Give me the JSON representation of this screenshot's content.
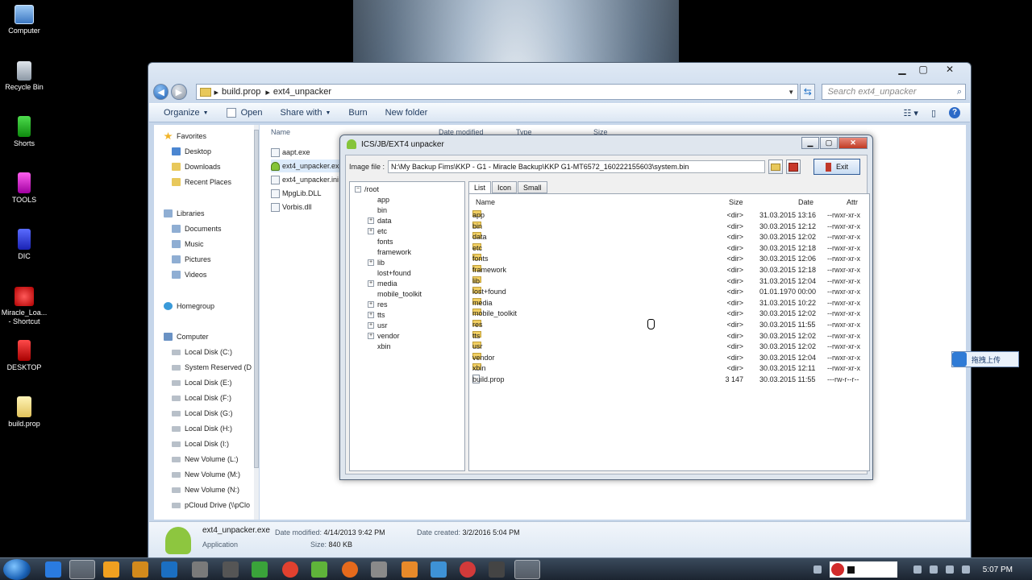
{
  "desktop_icons": [
    {
      "label": "Computer",
      "icon": "computer-icon"
    },
    {
      "label": "Recycle Bin",
      "icon": "recycle-bin-icon"
    },
    {
      "label": "Shorts",
      "icon": "green-folder-icon"
    },
    {
      "label": "TOOLS",
      "icon": "magenta-folder-icon"
    },
    {
      "label": "DIC",
      "icon": "blue-folder-icon"
    },
    {
      "label": "Miracle_Loa...",
      "label2": "- Shortcut",
      "icon": "miracle-shortcut-icon"
    },
    {
      "label": "DESKTOP",
      "icon": "red-folder-icon"
    },
    {
      "label": "build.prop",
      "icon": "file-icon"
    }
  ],
  "explorer": {
    "breadcrumb": [
      "build.prop",
      "ext4_unpacker"
    ],
    "search_placeholder": "Search ext4_unpacker",
    "toolbar": {
      "organize": "Organize",
      "open": "Open",
      "share_with": "Share with",
      "burn": "Burn",
      "new_folder": "New folder"
    },
    "nav_pane": [
      {
        "label": "Favorites",
        "icon": "star-icon",
        "indent": 0
      },
      {
        "label": "Desktop",
        "icon": "desktop-icon",
        "indent": 1
      },
      {
        "label": "Downloads",
        "icon": "folder-icon",
        "indent": 1
      },
      {
        "label": "Recent Places",
        "icon": "folder-icon",
        "indent": 1
      },
      {
        "label": "Libraries",
        "icon": "library-icon",
        "indent": 0
      },
      {
        "label": "Documents",
        "icon": "library-icon",
        "indent": 1
      },
      {
        "label": "Music",
        "icon": "library-icon",
        "indent": 1
      },
      {
        "label": "Pictures",
        "icon": "library-icon",
        "indent": 1
      },
      {
        "label": "Videos",
        "icon": "library-icon",
        "indent": 1
      },
      {
        "label": "Homegroup",
        "icon": "homegroup-icon",
        "indent": 0
      },
      {
        "label": "Computer",
        "icon": "computer-icon",
        "indent": 0
      },
      {
        "label": "Local Disk (C:)",
        "icon": "disk-icon",
        "indent": 1
      },
      {
        "label": "System Reserved (D",
        "icon": "disk-icon",
        "indent": 1
      },
      {
        "label": "Local Disk (E:)",
        "icon": "disk-icon",
        "indent": 1
      },
      {
        "label": "Local Disk (F:)",
        "icon": "disk-icon",
        "indent": 1
      },
      {
        "label": "Local Disk (G:)",
        "icon": "disk-icon",
        "indent": 1
      },
      {
        "label": "Local Disk (H:)",
        "icon": "disk-icon",
        "indent": 1
      },
      {
        "label": "Local Disk (I:)",
        "icon": "disk-icon",
        "indent": 1
      },
      {
        "label": "New Volume (L:)",
        "icon": "disk-icon",
        "indent": 1
      },
      {
        "label": "New Volume (M:)",
        "icon": "disk-icon",
        "indent": 1
      },
      {
        "label": "New Volume (N:)",
        "icon": "disk-icon",
        "indent": 1
      },
      {
        "label": "pCloud Drive (\\\\pClo",
        "icon": "disk-icon",
        "indent": 1
      }
    ],
    "columns": [
      "Name",
      "Date modified",
      "Type",
      "Size"
    ],
    "files": [
      {
        "name": "aapt.exe",
        "icon": "exe-icon"
      },
      {
        "name": "ext4_unpacker.exe",
        "icon": "android-icon",
        "selected": true
      },
      {
        "name": "ext4_unpacker.ini",
        "icon": "ini-icon"
      },
      {
        "name": "MpgLib.DLL",
        "icon": "dll-icon"
      },
      {
        "name": "Vorbis.dll",
        "icon": "dll-icon"
      }
    ],
    "details": {
      "name": "ext4_unpacker.exe",
      "type": "Application",
      "date_modified_label": "Date modified:",
      "date_modified": "4/14/2013 9:42 PM",
      "date_created_label": "Date created:",
      "date_created": "3/2/2016 5:04 PM",
      "size_label": "Size:",
      "size": "840 KB"
    }
  },
  "unpacker": {
    "title": "ICS/JB/EXT4 unpacker",
    "image_label": "Image file :",
    "image_path": "N:\\My Backup Fims\\KKP - G1 - Miracle Backup\\KKP G1-MT6572_160222155603\\system.bin",
    "exit_label": "Exit",
    "tree_root": "/root",
    "tree": [
      {
        "label": "app",
        "expand": false
      },
      {
        "label": "bin",
        "expand": false
      },
      {
        "label": "data",
        "expand": true
      },
      {
        "label": "etc",
        "expand": true
      },
      {
        "label": "fonts",
        "expand": false
      },
      {
        "label": "framework",
        "expand": false
      },
      {
        "label": "lib",
        "expand": true
      },
      {
        "label": "lost+found",
        "expand": false
      },
      {
        "label": "media",
        "expand": true
      },
      {
        "label": "mobile_toolkit",
        "expand": false
      },
      {
        "label": "res",
        "expand": true
      },
      {
        "label": "tts",
        "expand": true
      },
      {
        "label": "usr",
        "expand": true
      },
      {
        "label": "vendor",
        "expand": true
      },
      {
        "label": "xbin",
        "expand": false
      }
    ],
    "tabs": [
      "List",
      "Icon",
      "Small"
    ],
    "active_tab": "List",
    "list_columns": {
      "name": "Name",
      "size": "Size",
      "date": "Date",
      "attr": "Attr"
    },
    "entries": [
      {
        "name": "app",
        "size": "<dir>",
        "date": "31.03.2015 13:16",
        "attr": "--rwxr-xr-x",
        "kind": "dir"
      },
      {
        "name": "bin",
        "size": "<dir>",
        "date": "30.03.2015 12:12",
        "attr": "--rwxr-xr-x",
        "kind": "dir"
      },
      {
        "name": "data",
        "size": "<dir>",
        "date": "30.03.2015 12:02",
        "attr": "--rwxr-xr-x",
        "kind": "dir"
      },
      {
        "name": "etc",
        "size": "<dir>",
        "date": "30.03.2015 12:18",
        "attr": "--rwxr-xr-x",
        "kind": "dir"
      },
      {
        "name": "fonts",
        "size": "<dir>",
        "date": "30.03.2015 12:06",
        "attr": "--rwxr-xr-x",
        "kind": "dir"
      },
      {
        "name": "framework",
        "size": "<dir>",
        "date": "30.03.2015 12:18",
        "attr": "--rwxr-xr-x",
        "kind": "dir"
      },
      {
        "name": "lib",
        "size": "<dir>",
        "date": "31.03.2015 12:04",
        "attr": "--rwxr-xr-x",
        "kind": "dir"
      },
      {
        "name": "lost+found",
        "size": "<dir>",
        "date": "01.01.1970 00:00",
        "attr": "--rwxr-xr-x",
        "kind": "dir"
      },
      {
        "name": "media",
        "size": "<dir>",
        "date": "31.03.2015 10:22",
        "attr": "--rwxr-xr-x",
        "kind": "dir"
      },
      {
        "name": "mobile_toolkit",
        "size": "<dir>",
        "date": "30.03.2015 12:02",
        "attr": "--rwxr-xr-x",
        "kind": "dir"
      },
      {
        "name": "res",
        "size": "<dir>",
        "date": "30.03.2015 11:55",
        "attr": "--rwxr-xr-x",
        "kind": "dir"
      },
      {
        "name": "tts",
        "size": "<dir>",
        "date": "30.03.2015 12:02",
        "attr": "--rwxr-xr-x",
        "kind": "dir"
      },
      {
        "name": "usr",
        "size": "<dir>",
        "date": "30.03.2015 12:02",
        "attr": "--rwxr-xr-x",
        "kind": "dir"
      },
      {
        "name": "vendor",
        "size": "<dir>",
        "date": "30.03.2015 12:04",
        "attr": "--rwxr-xr-x",
        "kind": "dir"
      },
      {
        "name": "xbin",
        "size": "<dir>",
        "date": "30.03.2015 12:11",
        "attr": "--rwxr-xr-x",
        "kind": "dir"
      },
      {
        "name": "build.prop",
        "size": "3 147",
        "date": "30.03.2015 11:55",
        "attr": "---rw-r--r--",
        "kind": "file"
      }
    ]
  },
  "side_widget": {
    "label": "拖拽上传"
  },
  "taskbar": {
    "clock": "5:07 PM",
    "apps": [
      "ie-icon",
      "explorer-icon",
      "media-player-icon",
      "outlook-icon",
      "office-icon",
      "firefox-icon",
      "chrome-icon",
      "android-tool-icon",
      "opera-icon",
      "paint-icon",
      "network-icon",
      "record-icon",
      "unpacker-icon"
    ]
  }
}
